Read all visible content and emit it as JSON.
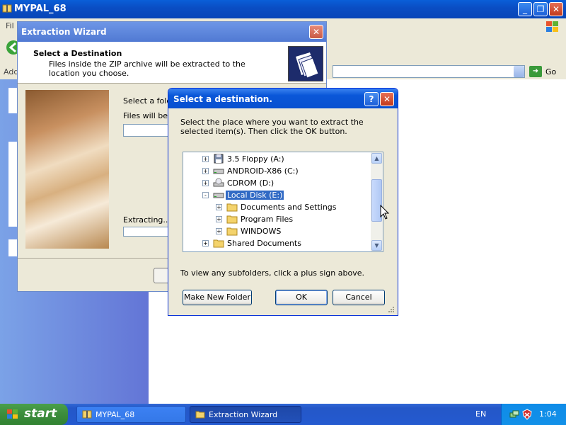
{
  "explorer": {
    "title": "MYPAL_68",
    "menu_first_letters": "Fil",
    "address_label": "Add",
    "go_label": "Go"
  },
  "wizard": {
    "title": "Extraction Wizard",
    "header_title": "Select a Destination",
    "header_desc": "Files inside the ZIP archive will be extracted to the location you choose.",
    "prompt": "Select a folde",
    "files_label": "Files will be ex",
    "extracting_label": "Extracting..."
  },
  "browse": {
    "title": "Select a destination.",
    "help": "?",
    "close": "X",
    "instructions": "Select the place where you want to extract the selected item(s).  Then click the OK button.",
    "tree": [
      {
        "label": "3.5 Floppy (A:)",
        "icon": "floppy-icon",
        "level": 1,
        "expander": "+",
        "selected": false
      },
      {
        "label": "ANDROID-X86 (C:)",
        "icon": "drive-icon",
        "level": 1,
        "expander": "+",
        "selected": false
      },
      {
        "label": "CDROM (D:)",
        "icon": "cdrom-icon",
        "level": 1,
        "expander": "+",
        "selected": false
      },
      {
        "label": "Local Disk (E:)",
        "icon": "drive-icon",
        "level": 1,
        "expander": "-",
        "selected": true
      },
      {
        "label": "Documents and Settings",
        "icon": "folder-icon",
        "level": 2,
        "expander": "+",
        "selected": false
      },
      {
        "label": "Program Files",
        "icon": "folder-icon",
        "level": 2,
        "expander": "+",
        "selected": false
      },
      {
        "label": "WINDOWS",
        "icon": "folder-icon",
        "level": 2,
        "expander": "+",
        "selected": false
      },
      {
        "label": "Shared Documents",
        "icon": "folder-icon",
        "level": 1,
        "expander": "+",
        "selected": false
      }
    ],
    "hint": "To view any subfolders, click a plus sign above.",
    "new_folder_label": "Make New Folder",
    "ok_label": "OK",
    "cancel_label": "Cancel"
  },
  "taskbar": {
    "start_label": "start",
    "tasks": [
      {
        "label": "MYPAL_68",
        "active": false
      },
      {
        "label": "Extraction Wizard",
        "active": true
      }
    ],
    "language": "EN",
    "clock": "1:04"
  },
  "colors": {
    "title_blue": "#0a57d8",
    "selection": "#316ac5",
    "start_green": "#3c8c3c",
    "taskbar_blue": "#245ad0"
  }
}
